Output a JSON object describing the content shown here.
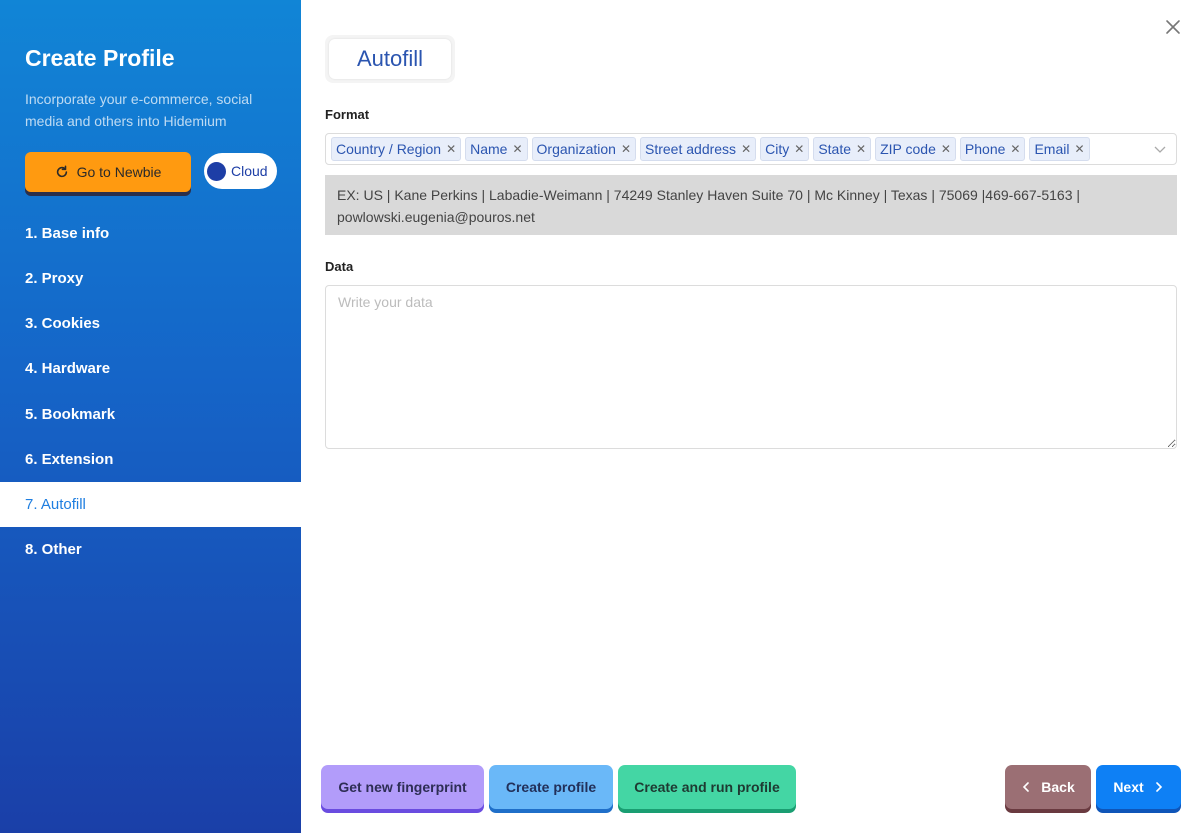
{
  "sidebar": {
    "title": "Create Profile",
    "subtitle": "Incorporate your e-commerce, social media and others into Hidemium",
    "newbie_button": "Go to Newbie",
    "cloud_toggle": "Cloud",
    "items": [
      {
        "label": "1. Base info"
      },
      {
        "label": "2. Proxy"
      },
      {
        "label": "3. Cookies"
      },
      {
        "label": "4. Hardware"
      },
      {
        "label": "5. Bookmark"
      },
      {
        "label": "6. Extension"
      },
      {
        "label": "7. Autofill",
        "active": true
      },
      {
        "label": "8. Other"
      }
    ]
  },
  "main": {
    "tab_title": "Autofill",
    "format_label": "Format",
    "format_tags": [
      "Country / Region",
      "Name",
      "Organization",
      "Street address",
      "City",
      "State",
      "ZIP code",
      "Phone",
      "Email"
    ],
    "example_text": "EX: US | Kane Perkins | Labadie-Weimann | 74249 Stanley Haven Suite 70 | Mc Kinney | Texas | 75069 |469-667-5163 | powlowski.eugenia@pouros.net",
    "data_label": "Data",
    "data_placeholder": "Write your data",
    "data_value": ""
  },
  "footer": {
    "fingerprint_button": "Get new fingerprint",
    "create_button": "Create profile",
    "create_run_button": "Create and run profile",
    "back_button": "Back",
    "next_button": "Next"
  },
  "icons": {
    "close": "close-icon",
    "refresh": "refresh-icon",
    "chevron_down": "chevron-down-icon",
    "chevron_left": "chevron-left-icon",
    "chevron_right": "chevron-right-icon"
  }
}
